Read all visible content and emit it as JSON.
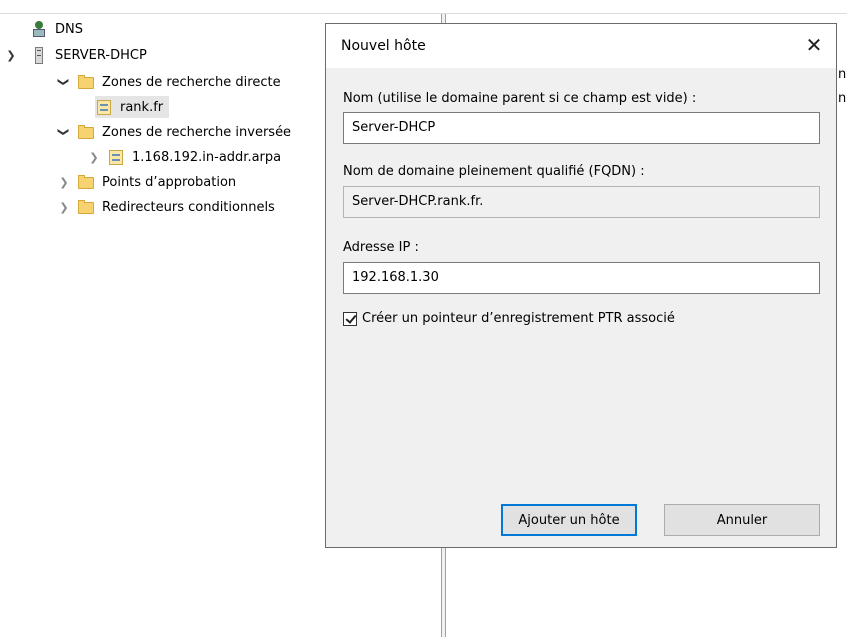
{
  "tree": {
    "items": [
      {
        "label": "DNS",
        "icon": "dns-icon"
      },
      {
        "label": "SERVER-DHCP",
        "icon": "server-icon"
      },
      {
        "label": "Zones de recherche directe",
        "icon": "folder-icon"
      },
      {
        "label": "rank.fr",
        "icon": "zone-icon"
      },
      {
        "label": "Zones de recherche inversée",
        "icon": "folder-icon"
      },
      {
        "label": "1.168.192.in-addr.arpa",
        "icon": "zone-icon"
      },
      {
        "label": "Points d’approbation",
        "icon": "folder-icon"
      },
      {
        "label": "Redirecteurs conditionnels",
        "icon": "folder-icon"
      }
    ]
  },
  "right_pane": {
    "visible_fragments": [
      "n",
      "n"
    ]
  },
  "dialog": {
    "title": "Nouvel hôte",
    "name_label": "Nom (utilise le domaine parent si ce champ est vide) :",
    "name_value": "Server-DHCP",
    "fqdn_label": "Nom de domaine pleinement qualifié (FQDN) :",
    "fqdn_value": "Server-DHCP.rank.fr.",
    "ip_label": "Adresse IP :",
    "ip_value": "192.168.1.30",
    "ptr_checkbox_label": "Créer un pointeur d’enregistrement PTR associé",
    "ptr_checked": true,
    "add_button": "Ajouter un hôte",
    "cancel_button": "Annuler"
  },
  "colors": {
    "accent": "#0078d7",
    "dialog_bg": "#f0f0f0",
    "folder": "#f6d271"
  }
}
